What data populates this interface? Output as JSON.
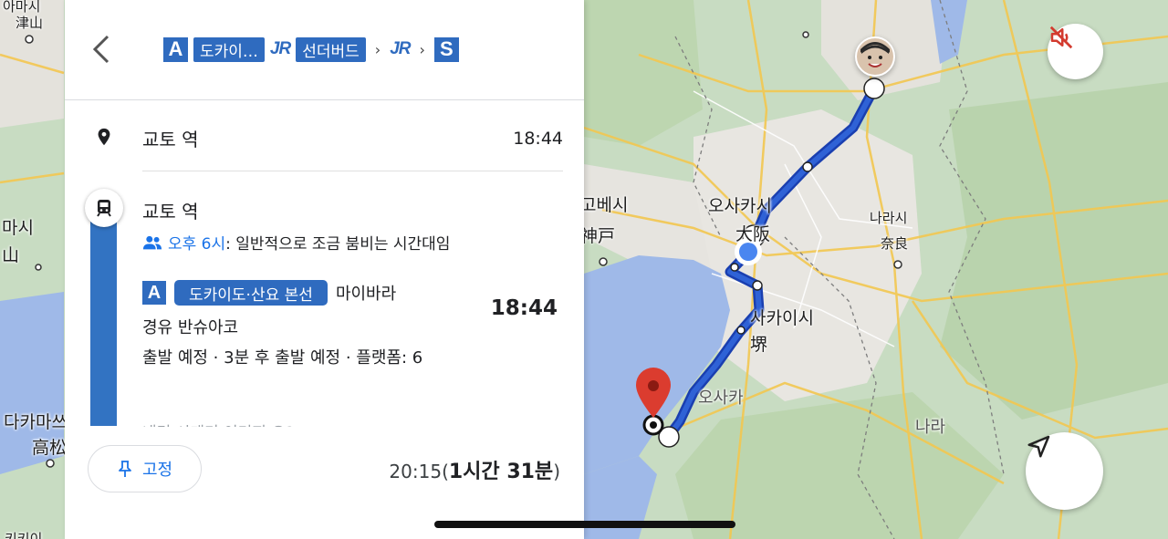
{
  "header": {
    "back_label": "back",
    "chips": [
      {
        "type": "letter",
        "text": "A"
      },
      {
        "type": "line",
        "text": "도카이…"
      },
      {
        "type": "jr",
        "text": "JR"
      },
      {
        "type": "line",
        "text": "선더버드"
      },
      {
        "type": "sep",
        "text": "›"
      },
      {
        "type": "jr",
        "text": "JR"
      },
      {
        "type": "sep",
        "text": "›"
      },
      {
        "type": "letter",
        "text": "S"
      }
    ]
  },
  "origin": {
    "name": "교토 역",
    "time": "18:44"
  },
  "transit": {
    "station": "교토 역",
    "crowd_time": "오후 6시",
    "crowd_text": ": 일반적으로 조금 붐비는 시간대임",
    "line_letter": "A",
    "line_name": "도카이도·산요 본선",
    "destination": "마이바라",
    "via": "경유 반슈아코",
    "depart_info": "출발 예정 · 3분 후 출발 예정 · 플랫폼: 6",
    "depart_time": "18:44",
    "faded_text": "내리 시게기 이미지 요?"
  },
  "footer": {
    "pin_label": "고정",
    "arrival_time": "20:15",
    "duration": "1시간 31분"
  },
  "map": {
    "labels": {
      "top_left_1": "아마시",
      "top_left_2": "津山",
      "left_1": "마시",
      "left_2": "山",
      "kobe_ko": "고베시",
      "kobe_ja": "神戸",
      "osaka_ko": "오사카시",
      "osaka_ja": "大阪",
      "nara_city_ko": "나라시",
      "nara_city_ja": "奈良",
      "sakai_ko": "사카이시",
      "sakai_ja": "堺",
      "osaka_pref": "오사카",
      "nara_pref": "나라",
      "takamatsu_ko": "다카마쓰",
      "takamatsu_ja": "高松",
      "bottom_left": "키키이"
    }
  },
  "colors": {
    "accent": "#1a73e8",
    "line": "#2f6bbf",
    "route": "#1f4fc4"
  }
}
